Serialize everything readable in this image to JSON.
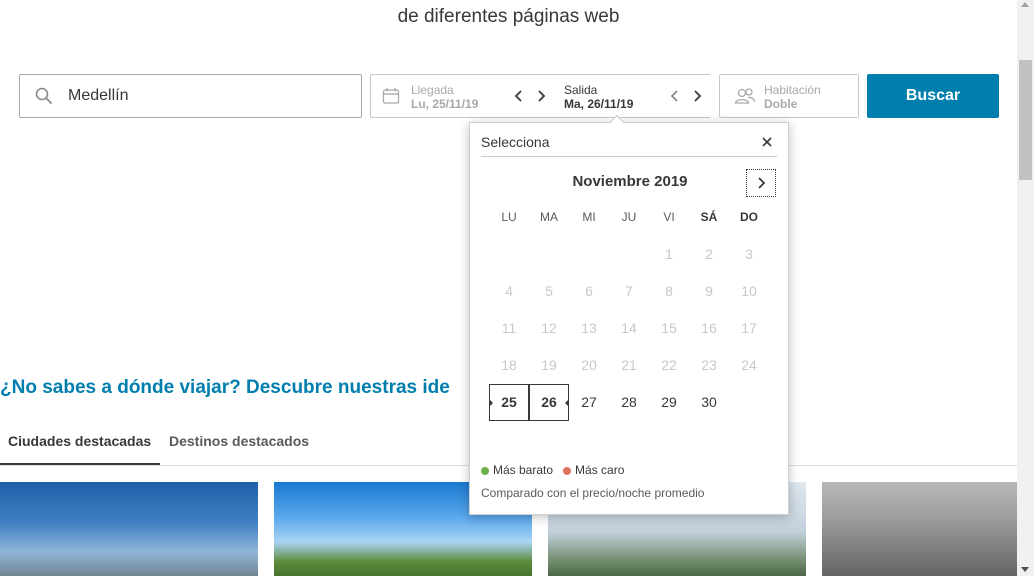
{
  "tagline": "de diferentes páginas web",
  "search": {
    "destination": "Medellín",
    "checkin_label": "Llegada",
    "checkin_value": "Lu, 25/11/19",
    "checkout_label": "Salida",
    "checkout_value": "Ma, 26/11/19",
    "room_label": "Habitación",
    "room_value": "Doble",
    "button": "Buscar"
  },
  "calendar": {
    "title": "Selecciona",
    "month": "Noviembre 2019",
    "weekdays": [
      "LU",
      "MA",
      "MI",
      "JU",
      "VI",
      "SÁ",
      "DO"
    ],
    "days": [
      "1",
      "2",
      "3",
      "4",
      "5",
      "6",
      "7",
      "8",
      "9",
      "10",
      "11",
      "12",
      "13",
      "14",
      "15",
      "16",
      "17",
      "18",
      "19",
      "20",
      "21",
      "22",
      "23",
      "24",
      "25",
      "26",
      "27",
      "28",
      "29",
      "30"
    ],
    "first_weekday_index": 4,
    "selected_start": "25",
    "selected_end": "26",
    "legend_cheap": "Más barato",
    "legend_expensive": "Más caro",
    "legend_cheap_color": "#6ab04c",
    "legend_expensive_color": "#e0735e",
    "note": "Comparado con el precio/noche promedio"
  },
  "headline": "¿No sabes a dónde viajar? Descubre nuestras ide",
  "tabs": [
    "Ciudades destacadas",
    "Destinos destacados"
  ],
  "colors": {
    "accent": "#007faf"
  }
}
